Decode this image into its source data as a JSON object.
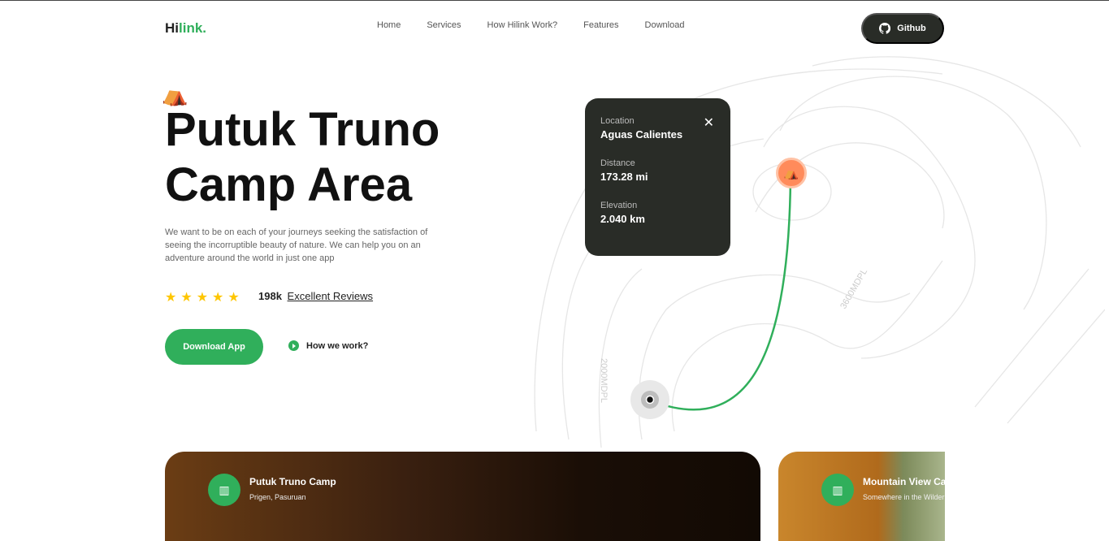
{
  "nav": {
    "logo_a": "Hi",
    "logo_b": "link.",
    "links": [
      "Home",
      "Services",
      "How Hilink Work?",
      "Features",
      "Download"
    ],
    "github": "Github"
  },
  "hero": {
    "title_1": "Putuk Truno",
    "title_2": "Camp Area",
    "description": "We want to be on each of your journeys seeking the satisfaction of seeing the incorruptible beauty of nature. We can help you on an adventure around the world in just one app",
    "rating_stars": 5,
    "review_count": "198k",
    "review_label": "Excellent Reviews",
    "download": "Download App",
    "how": "How we work?"
  },
  "map": {
    "label_a": "2000MDPL",
    "label_b": "3600MDPL",
    "accent": "#30af5b"
  },
  "card": {
    "location_label": "Location",
    "location": "Aguas Calientes",
    "distance_label": "Distance",
    "distance": "173.28 mi",
    "elevation_label": "Elevation",
    "elevation": "2.040 km"
  },
  "places": [
    {
      "title": "Putuk Truno Camp",
      "subtitle": "Prigen, Pasuruan"
    },
    {
      "title": "Mountain View Camp",
      "subtitle": "Somewhere in the Wilderness"
    }
  ]
}
